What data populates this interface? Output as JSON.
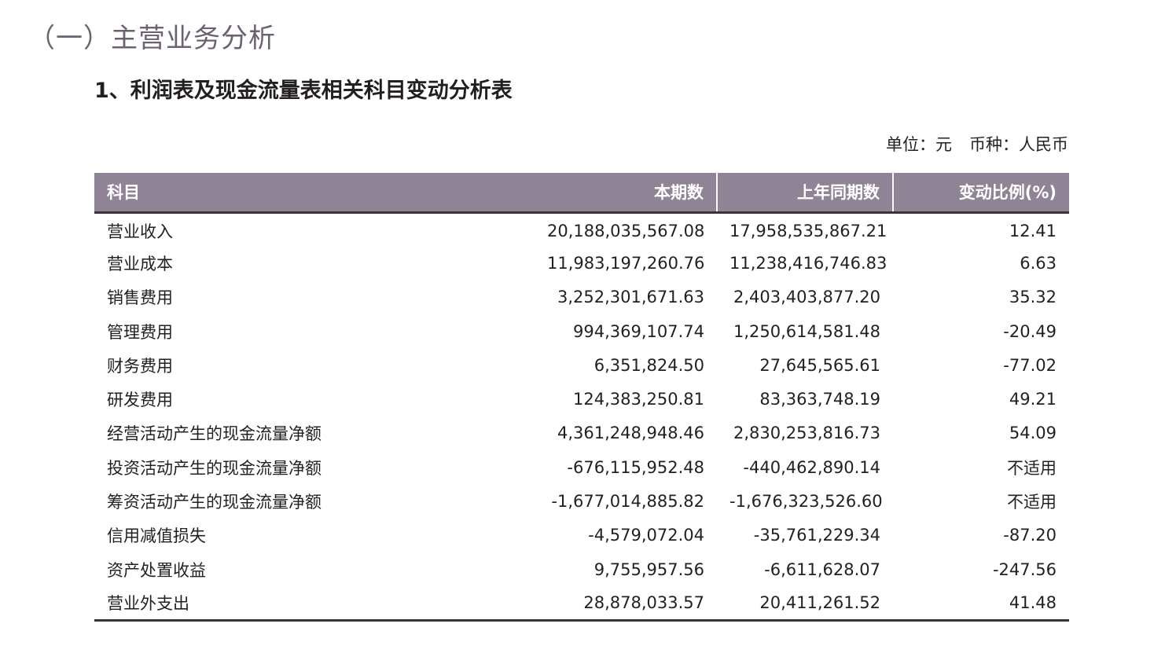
{
  "section_title": "（一）主营业务分析",
  "sub_title": "1、利润表及现金流量表相关科目变动分析表",
  "unit": {
    "unit_label": "单位：元",
    "currency_label": "币种：人民币"
  },
  "table": {
    "headers": [
      "科目",
      "本期数",
      "上年同期数",
      "变动比例(%)"
    ],
    "rows": [
      [
        "营业收入",
        "20,188,035,567.08",
        "17,958,535,867.21",
        "12.41"
      ],
      [
        "营业成本",
        "11,983,197,260.76",
        "11,238,416,746.83",
        "6.63"
      ],
      [
        "销售费用",
        "3,252,301,671.63",
        "2,403,403,877.20",
        "35.32"
      ],
      [
        "管理费用",
        "994,369,107.74",
        "1,250,614,581.48",
        "-20.49"
      ],
      [
        "财务费用",
        "6,351,824.50",
        "27,645,565.61",
        "-77.02"
      ],
      [
        "研发费用",
        "124,383,250.81",
        "83,363,748.19",
        "49.21"
      ],
      [
        "经营活动产生的现金流量净额",
        "4,361,248,948.46",
        "2,830,253,816.73",
        "54.09"
      ],
      [
        "投资活动产生的现金流量净额",
        "-676,115,952.48",
        "-440,462,890.14",
        "不适用"
      ],
      [
        "筹资活动产生的现金流量净额",
        "-1,677,014,885.82",
        "-1,676,323,526.60",
        "不适用"
      ],
      [
        "信用减值损失",
        "-4,579,072.04",
        "-35,761,229.34",
        "-87.20"
      ],
      [
        "资产处置收益",
        "9,755,957.56",
        "-6,611,628.07",
        "-247.56"
      ],
      [
        "营业外支出",
        "28,878,033.57",
        "20,411,261.52",
        "41.48"
      ]
    ]
  },
  "colors": {
    "header_bg": "#8f8495",
    "section_title": "#6b6271",
    "text": "#231f20",
    "rule": "#3a3338"
  }
}
